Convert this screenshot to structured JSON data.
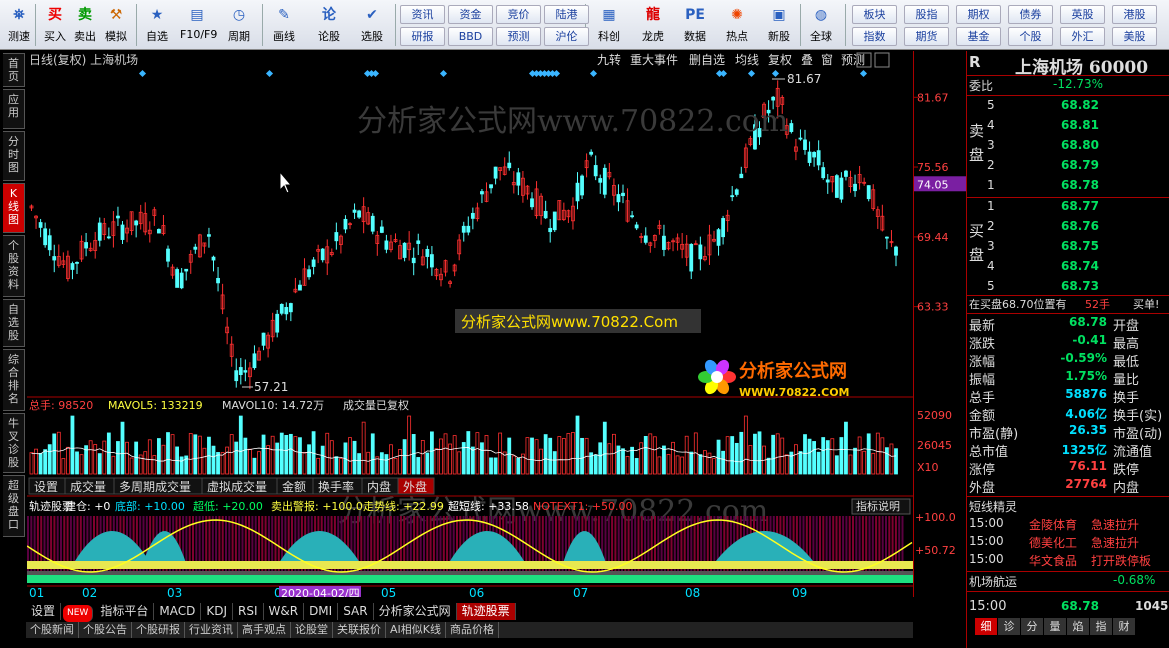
{
  "toolbar": {
    "buttons": [
      {
        "label": "测速",
        "icon": "⛯",
        "name": "speedtest",
        "color": "#2a60c0"
      },
      {
        "label": "买入",
        "icon": "买",
        "name": "buy",
        "color": "#e00"
      },
      {
        "label": "卖出",
        "icon": "卖",
        "name": "sell",
        "color": "#090"
      },
      {
        "label": "模拟",
        "icon": "⚒",
        "name": "simulate",
        "color": "#c60"
      },
      {
        "label": "自选",
        "icon": "★",
        "name": "watchlist",
        "color": "#2a60c0"
      },
      {
        "label": "F10/F9",
        "icon": "▤",
        "name": "f10",
        "color": "#2a60c0"
      },
      {
        "label": "周期",
        "icon": "◷",
        "name": "period",
        "color": "#2a60c0"
      },
      {
        "label": "画线",
        "icon": "✎",
        "name": "drawline",
        "color": "#2a60c0"
      },
      {
        "label": "论股",
        "icon": "论",
        "name": "discuss",
        "color": "#2a60c0"
      },
      {
        "label": "选股",
        "icon": "✔",
        "name": "stockpick",
        "color": "#2a60c0"
      },
      {
        "label": "科创",
        "icon": "▦",
        "name": "kechuang",
        "color": "#2a60c0"
      },
      {
        "label": "龙虎",
        "icon": "龍",
        "name": "longhu",
        "color": "#d00"
      },
      {
        "label": "数据",
        "icon": "PE",
        "name": "data",
        "color": "#2a60c0"
      },
      {
        "label": "热点",
        "icon": "✺",
        "name": "hotspot",
        "color": "#e40"
      },
      {
        "label": "新股",
        "icon": "▣",
        "name": "newstock",
        "color": "#2a60c0"
      },
      {
        "label": "全球",
        "icon": "◍",
        "name": "global",
        "color": "#2a60c0"
      }
    ],
    "grid1": [
      "资讯",
      "资金",
      "竞价",
      "陆港",
      "研报",
      "BBD",
      "预测",
      "沪伦"
    ],
    "grid2": [
      "板块",
      "股指",
      "期权",
      "债券",
      "英股",
      "港股",
      "指数",
      "期货",
      "基金",
      "个股",
      "外汇",
      "美股"
    ]
  },
  "left_tabs": [
    "首页",
    "应用",
    "分时图",
    "K线图",
    "个股资料",
    "自选股",
    "综合排名",
    "牛叉诊股",
    "超级盘口"
  ],
  "chart": {
    "header": "日线(复权) 上海机场",
    "menu": [
      "九转",
      "重大事件",
      "删自选",
      "均线",
      "复权",
      "叠",
      "窗",
      "预测"
    ],
    "watermark": "分析家公式网www.70822.com",
    "banner": "分析家公式网www.70822.Com",
    "logo_text": "分析家公式网",
    "logo_url": "WWW.70822.COM",
    "high_label": "81.67",
    "low_label": "57.21",
    "price_ticks": [
      "81.67",
      "75.56",
      "69.44",
      "63.33"
    ],
    "current_price": "74.05",
    "vol_header": {
      "total": "总手: 98520",
      "ma5": "MAVOL5: 133219",
      "ma10": "MAVOL10: 14.72万",
      "note": "成交量已复权"
    },
    "vol_ticks": [
      "52090",
      "26045",
      "X10"
    ],
    "vol_tabs": [
      "设置",
      "成交量",
      "多周期成交量",
      "虚拟成交量",
      "金额",
      "换手率",
      "内盘",
      "外盘"
    ],
    "ind_header": {
      "name": "轨迹股票",
      "a": "建仓: +0",
      "b": "底部: +10.00",
      "c": "超低: +20.00",
      "d": "卖出警报: +100.0",
      "e": "走势线: +22.99",
      "f": "超短线: +33.58",
      "g": "NOTEXT1: +50.00",
      "btn": "指标说明"
    },
    "ind_ticks": [
      "+100.0",
      "+50.72"
    ],
    "months": [
      "01",
      "02",
      "03",
      "04",
      "05",
      "06",
      "07",
      "08",
      "09"
    ],
    "date_label": "2020-04-02/四"
  },
  "bottom_tabs": [
    "设置",
    "NEW",
    "指标平台",
    "MACD",
    "KDJ",
    "RSI",
    "W&R",
    "DMI",
    "SAR",
    "分析家公式网",
    "轨迹股票"
  ],
  "bottom2": [
    "个股新闻",
    "个股公告",
    "个股研报",
    "行业资讯",
    "高手观点",
    "论股堂",
    "关联报价",
    "AI相似K线",
    "商品价格"
  ],
  "quote": {
    "code": "R",
    "name": "上海机场 60000",
    "weibi": {
      "label": "委比",
      "value": "-12.73%"
    },
    "sell": [
      [
        "5",
        "68.82"
      ],
      [
        "4",
        "68.81"
      ],
      [
        "3",
        "68.80"
      ],
      [
        "2",
        "68.79"
      ],
      [
        "1",
        "68.78"
      ]
    ],
    "buy": [
      [
        "1",
        "68.77"
      ],
      [
        "2",
        "68.76"
      ],
      [
        "3",
        "68.75"
      ],
      [
        "4",
        "68.74"
      ],
      [
        "5",
        "68.73"
      ]
    ],
    "sell_label": "卖盘",
    "buy_label": "买盘",
    "status": {
      "text": "在买盘68.70位置有",
      "qty": "52手",
      "action": "买单!"
    },
    "stats": [
      [
        "最新",
        "68.78",
        "开盘",
        ""
      ],
      [
        "涨跌",
        "-0.41",
        "最高",
        ""
      ],
      [
        "涨幅",
        "-0.59%",
        "最低",
        ""
      ],
      [
        "振幅",
        "1.75%",
        "量比",
        ""
      ],
      [
        "总手",
        "58876",
        "换手",
        ""
      ],
      [
        "金额",
        "4.06亿",
        "换手(实)",
        ""
      ],
      [
        "市盈(静)",
        "26.35",
        "市盈(动)",
        ""
      ],
      [
        "总市值",
        "1325亿",
        "流通值",
        ""
      ],
      [
        "涨停",
        "76.11",
        "跌停",
        ""
      ],
      [
        "外盘",
        "27764",
        "内盘",
        ""
      ]
    ],
    "fairy_title": "短线精灵",
    "fairy": [
      [
        "15:00",
        "金陵体育",
        "急速拉升"
      ],
      [
        "15:00",
        "德美化工",
        "急速拉升"
      ],
      [
        "15:00",
        "华文食品",
        "打开跌停板"
      ]
    ],
    "sector": {
      "name": "机场航运",
      "change": "-0.68%"
    },
    "tick": {
      "time": "15:00",
      "price": "68.78",
      "vol": "1045"
    },
    "tabs": [
      "细",
      "诊",
      "分",
      "量",
      "焰",
      "指",
      "财"
    ]
  },
  "colors": {
    "up": "#ff3030",
    "down": "#54ffff",
    "accent": "#c00"
  }
}
